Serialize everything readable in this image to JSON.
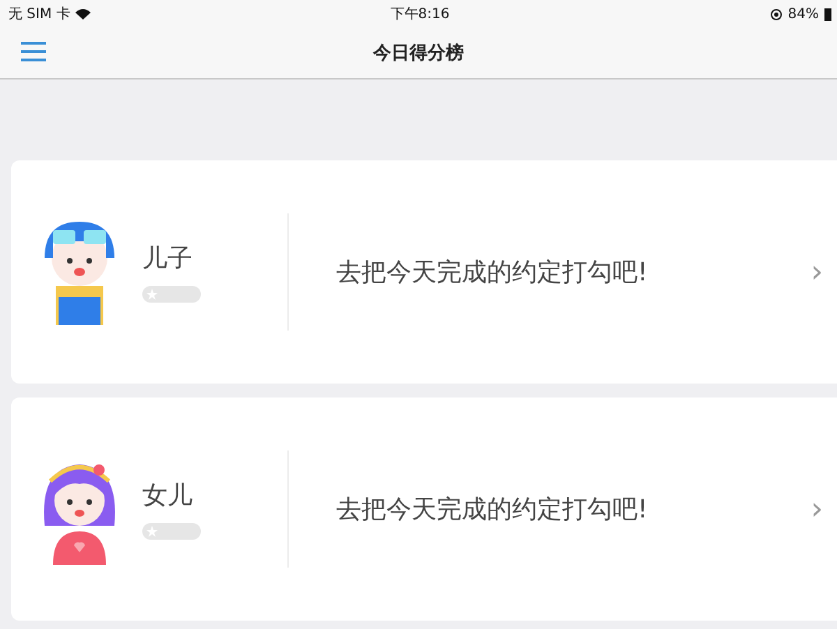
{
  "status_bar": {
    "carrier": "无 SIM 卡",
    "time": "下午8:16",
    "battery": "84%"
  },
  "nav": {
    "title": "今日得分榜"
  },
  "children": [
    {
      "name": "儿子",
      "kind": "boy",
      "prompt": "去把今天完成的约定打勾吧!",
      "chevron": "›"
    },
    {
      "name": "女儿",
      "kind": "girl",
      "prompt": "去把今天完成的约定打勾吧!",
      "chevron": "›"
    }
  ]
}
